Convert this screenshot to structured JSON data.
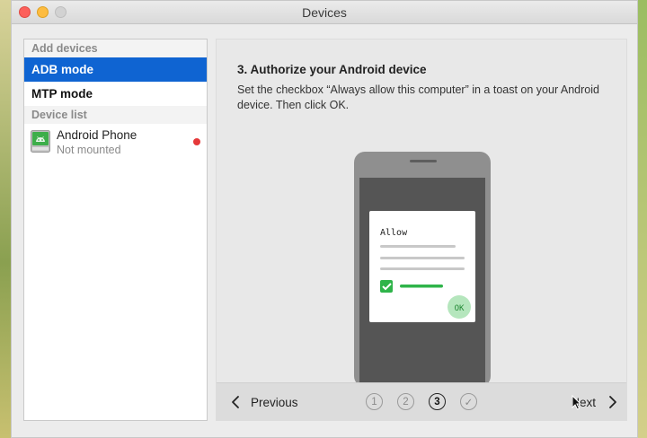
{
  "window": {
    "title": "Devices"
  },
  "sidebar": {
    "add_devices_header": "Add devices",
    "modes": [
      {
        "label": "ADB mode",
        "selected": true
      },
      {
        "label": "MTP mode",
        "selected": false
      }
    ],
    "device_list_header": "Device list",
    "devices": [
      {
        "name": "Android Phone",
        "status": "Not mounted",
        "status_color": "#e5393a",
        "icon": "android-phone-icon"
      }
    ]
  },
  "main": {
    "step_title": "3. Authorize your Android device",
    "step_text": "Set the checkbox “Always allow this computer” in a toast on your Android device. Then click OK.",
    "illustration": {
      "dialog_title": "Allow",
      "ok_label": "OK",
      "checkbox_checked": true
    }
  },
  "footer": {
    "previous_label": "Previous",
    "next_label": "Next",
    "steps": [
      "1",
      "2",
      "3",
      "✓"
    ],
    "current_step": 3
  },
  "colors": {
    "accent": "#0f64d2",
    "check_green": "#2fb44a",
    "status_red": "#e5393a"
  }
}
